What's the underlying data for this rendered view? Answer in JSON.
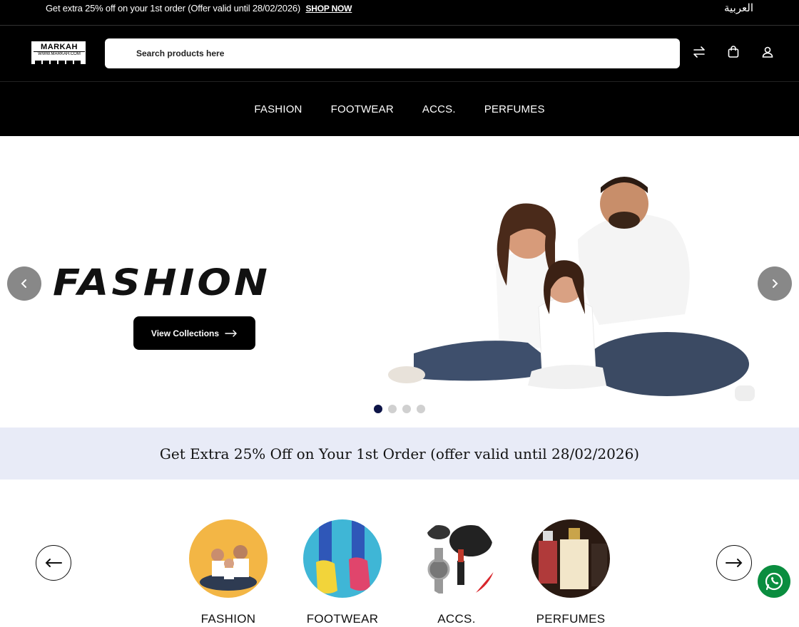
{
  "topbar": {
    "promo_text": "Get extra 25% off on your 1st order (Offer valid until 28/02/2026)",
    "shop_now": "SHOP NOW",
    "language": "العربية"
  },
  "header": {
    "logo_text": "MARKAH",
    "logo_url_text": "WWW.MARKAH.COM",
    "search_placeholder": "Search products here",
    "icons": [
      "compare-icon",
      "cart-icon",
      "user-icon"
    ]
  },
  "nav": {
    "items": [
      "FASHION",
      "FOOTWEAR",
      "ACCS.",
      "PERFUMES"
    ]
  },
  "hero": {
    "title": "FASHION",
    "cta_label": "View Collections",
    "slide_count": 4,
    "active_slide": 1
  },
  "offer_banner": {
    "text": "Get Extra 25% Off on Your 1st Order (offer valid until 28/02/2026)"
  },
  "categories": {
    "items": [
      {
        "label": "FASHION"
      },
      {
        "label": "FOOTWEAR"
      },
      {
        "label": "ACCS."
      },
      {
        "label": "PERFUMES"
      }
    ]
  },
  "colors": {
    "header_bg": "#000000",
    "offer_bg": "#e8ebf7",
    "active_dot": "#0d1447",
    "whatsapp": "#0a8d3f"
  }
}
